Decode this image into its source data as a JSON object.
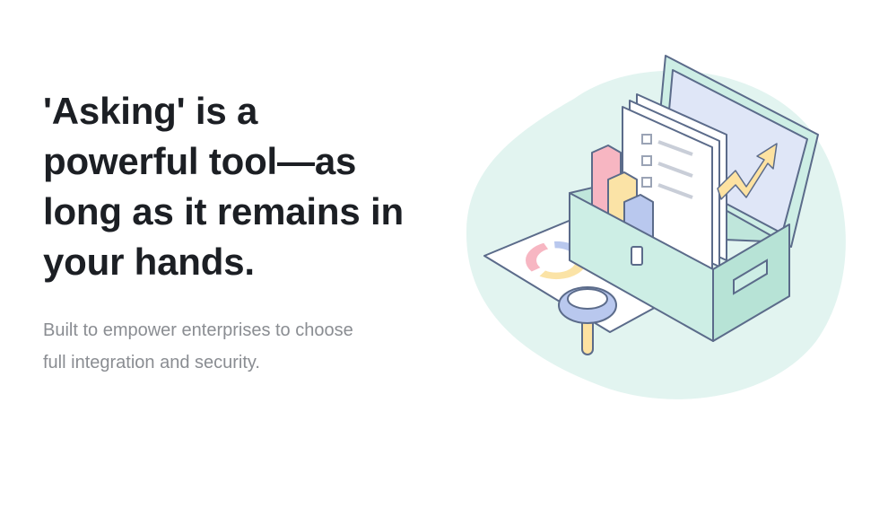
{
  "hero": {
    "title_lines": [
      "'Asking' is a",
      "powerful tool—as",
      "long as it remains in",
      "your hands."
    ],
    "subtitle_lines": [
      "Built to empower enterprises to choose",
      "full integration and security."
    ]
  },
  "illustration": {
    "icon": "toolbox-documents-illustration",
    "colors": {
      "blob": "#e2f4f0",
      "box": "#cdeee5",
      "outline": "#5b6b8a",
      "paper": "#ffffff",
      "screen": "#dfe6f7",
      "bar_pink": "#f7b6c2",
      "bar_yellow": "#fbe3a6",
      "bar_blue": "#b9c8ee",
      "arrow": "#fde2a1"
    }
  }
}
